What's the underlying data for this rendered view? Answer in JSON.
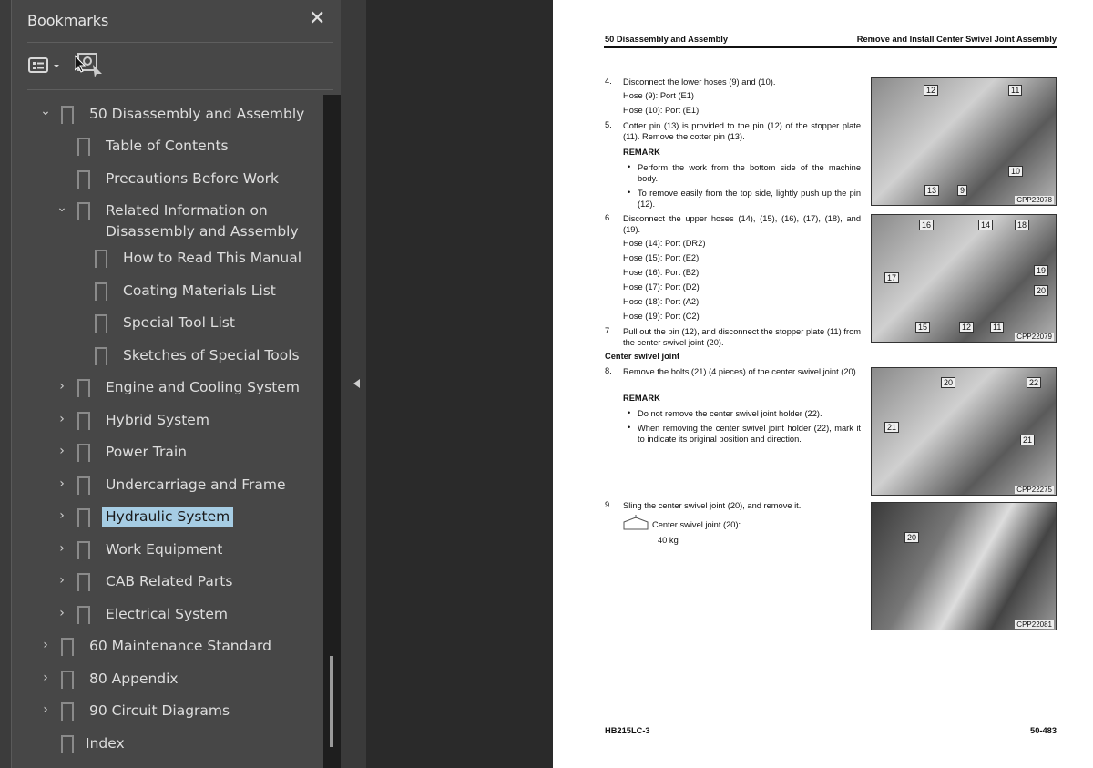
{
  "panel": {
    "title": "Bookmarks",
    "close": "✕"
  },
  "tree": [
    {
      "label": "50 Disassembly and Assembly",
      "level": 0,
      "chev": "⌄"
    },
    {
      "label": "Table of Contents",
      "level": 1,
      "chev": ""
    },
    {
      "label": "Precautions Before Work",
      "level": 1,
      "chev": ""
    },
    {
      "label": "Related Information on Disassembly and Assembly",
      "level": 1,
      "chev": "⌄"
    },
    {
      "label": "How to Read This Manual",
      "level": 2,
      "chev": ""
    },
    {
      "label": "Coating Materials List",
      "level": 2,
      "chev": ""
    },
    {
      "label": "Special Tool List",
      "level": 2,
      "chev": ""
    },
    {
      "label": "Sketches of Special Tools",
      "level": 2,
      "chev": ""
    },
    {
      "label": "Engine and Cooling System",
      "level": 1,
      "chev": "›"
    },
    {
      "label": "Hybrid System",
      "level": 1,
      "chev": "›"
    },
    {
      "label": "Power Train",
      "level": 1,
      "chev": "›"
    },
    {
      "label": "Undercarriage and Frame",
      "level": 1,
      "chev": "›"
    },
    {
      "label": "Hydraulic System",
      "level": 1,
      "chev": "›",
      "selected": true
    },
    {
      "label": "Work Equipment",
      "level": 1,
      "chev": "›"
    },
    {
      "label": "CAB Related Parts",
      "level": 1,
      "chev": "›"
    },
    {
      "label": "Electrical System",
      "level": 1,
      "chev": "›"
    },
    {
      "label": "60 Maintenance Standard",
      "level": 0,
      "chev": "›"
    },
    {
      "label": "80 Appendix",
      "level": 0,
      "chev": "›"
    },
    {
      "label": "90 Circuit Diagrams",
      "level": 0,
      "chev": "›"
    },
    {
      "label": "Index",
      "level": 0,
      "chev": "",
      "noChev": true
    }
  ],
  "page": {
    "header_left": "50 Disassembly and Assembly",
    "header_right": "Remove and Install Center Swivel Joint Assembly",
    "s4": "4.",
    "s4t": "Disconnect the lower hoses (9) and (10).",
    "h9": "Hose (9): Port (E1)",
    "h10": "Hose (10): Port (E1)",
    "s5": "5.",
    "s5t": "Cotter pin (13) is provided to the pin (12) of the stopper plate (11). Remove the cotter pin (13).",
    "remark": "REMARK",
    "r1": "Perform the work from the bottom side of the machine body.",
    "r2": "To remove easily from the top side, lightly push up the pin (12).",
    "s6": "6.",
    "s6t": "Disconnect the upper hoses (14), (15), (16), (17), (18), and (19).",
    "h14": "Hose (14): Port (DR2)",
    "h15": "Hose (15): Port (E2)",
    "h16": "Hose (16): Port (B2)",
    "h17": "Hose (17): Port (D2)",
    "h18": "Hose (18): Port (A2)",
    "h19": "Hose (19): Port (C2)",
    "s7": "7.",
    "s7t": "Pull out the pin (12), and disconnect the stopper plate (11) from the center swivel joint (20).",
    "section": "Center swivel joint",
    "s8": "8.",
    "s8t": "Remove the bolts (21) (4 pieces) of the center swivel joint (20).",
    "r3": "Do not remove the center swivel joint holder (22).",
    "r4": "When removing the center swivel joint holder (22), mark it to indicate its original position and direction.",
    "s9": "9.",
    "s9t": "Sling the center swivel joint (20), and remove it.",
    "weight_label": "Center swivel joint (20):",
    "weight": "40 kg",
    "footer_left": "HB215LC-3",
    "footer_right": "50-483",
    "fig1": {
      "code": "CPP22078",
      "labels": [
        "12",
        "11",
        "10",
        "13",
        "9"
      ]
    },
    "fig2": {
      "code": "CPP22079",
      "labels": [
        "16",
        "14",
        "18",
        "17",
        "19",
        "20",
        "15",
        "12",
        "11"
      ]
    },
    "fig3": {
      "code": "CPP22275",
      "labels": [
        "20",
        "22",
        "21",
        "21"
      ]
    },
    "fig4": {
      "code": "CPP22081",
      "labels": [
        "20"
      ]
    }
  }
}
